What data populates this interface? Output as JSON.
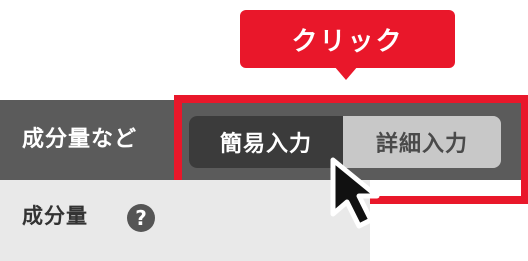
{
  "callout": {
    "text": "クリック"
  },
  "header": {
    "label": "成分量など"
  },
  "input_mode_toggle": {
    "options": [
      {
        "label": "簡易入力",
        "selected": true
      },
      {
        "label": "詳細入力",
        "selected": false
      }
    ]
  },
  "lower": {
    "label": "成分量",
    "help_icon": "?"
  },
  "icons": {
    "cursor": "arrow-cursor-icon",
    "help": "question-circle-icon"
  },
  "colors": {
    "accent_red": "#e9172a",
    "header_bg": "#5b5b5b",
    "selected_segment": "#3b3b3b",
    "unselected_segment": "#c8c8c8"
  }
}
